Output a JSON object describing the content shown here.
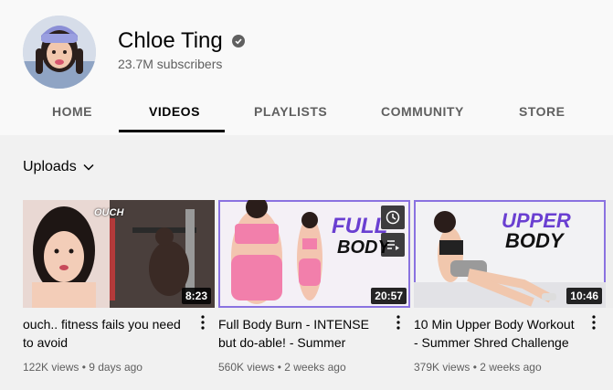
{
  "channel": {
    "name": "Chloe Ting",
    "subscribers": "23.7M subscribers"
  },
  "tabs": [
    {
      "label": "HOME"
    },
    {
      "label": "VIDEOS"
    },
    {
      "label": "PLAYLISTS"
    },
    {
      "label": "COMMUNITY"
    },
    {
      "label": "STORE"
    }
  ],
  "active_tab": "VIDEOS",
  "uploads_label": "Uploads",
  "videos": [
    {
      "title": "ouch.. fitness fails you need to avoid",
      "duration": "8:23",
      "views": "122K views",
      "age": "9 days ago",
      "thumb_text": "OUCH"
    },
    {
      "title": "Full Body Burn - INTENSE but do-able! - Summer Shred…",
      "duration": "20:57",
      "views": "560K views",
      "age": "2 weeks ago",
      "thumb_text_1": "FULL",
      "thumb_text_2": "BODY"
    },
    {
      "title": "10 Min Upper Body Workout - Summer Shred Challenge",
      "duration": "10:46",
      "views": "379K views",
      "age": "2 weeks ago",
      "thumb_text_1": "UPPER",
      "thumb_text_2": "BODY"
    }
  ],
  "colors": {
    "accent_purple": "#5b3cc4",
    "pink": "#f27fab",
    "text_secondary": "#606060"
  }
}
